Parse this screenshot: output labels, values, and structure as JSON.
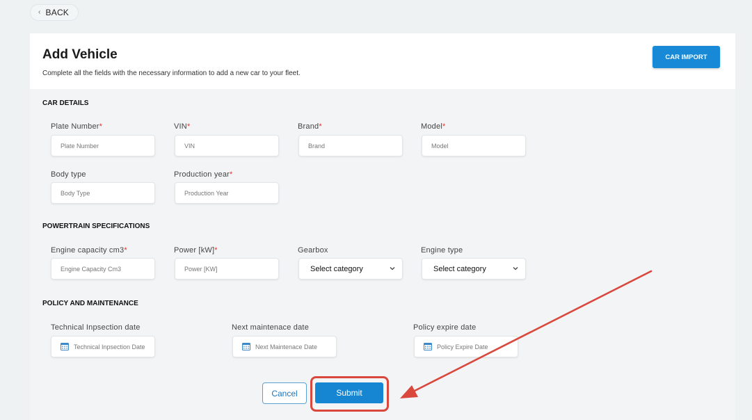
{
  "nav": {
    "back_label": "BACK"
  },
  "header": {
    "title": "Add Vehicle",
    "description": "Complete all the fields with the necessary information to add a new car to your fleet.",
    "car_import_label": "CAR IMPORT"
  },
  "car_details": {
    "title": "CAR DETAILS",
    "plate_number": {
      "label": "Plate Number",
      "required": "*",
      "placeholder": "Plate Number"
    },
    "vin": {
      "label": "VIN",
      "required": "*",
      "placeholder": "VIN"
    },
    "brand": {
      "label": "Brand",
      "required": "*",
      "placeholder": "Brand"
    },
    "model": {
      "label": "Model",
      "required": "*",
      "placeholder": "Model"
    },
    "body_type": {
      "label": "Body type",
      "placeholder": "Body Type"
    },
    "production_year": {
      "label": "Production year",
      "required": "*",
      "placeholder": "Production Year"
    }
  },
  "powertrain": {
    "title": "POWERTRAIN SPECIFICATIONS",
    "engine_capacity": {
      "label": "Engine capacity cm3",
      "required": "*",
      "placeholder": "Engine Capacity Cm3"
    },
    "power": {
      "label": "Power [kW]",
      "required": "*",
      "placeholder": "Power [KW]"
    },
    "gearbox": {
      "label": "Gearbox",
      "value": "Select category"
    },
    "engine_type": {
      "label": "Engine type",
      "value": "Select category"
    }
  },
  "policy": {
    "title": "POLICY AND MAINTENANCE",
    "technical_inspection": {
      "label": "Technical Inpsection date",
      "placeholder": "Technical Inpsection Date"
    },
    "next_maintenance": {
      "label": "Next maintenace date",
      "placeholder": "Next Maintenace Date"
    },
    "policy_expire": {
      "label": "Policy expire date",
      "placeholder": "Policy Expire Date"
    }
  },
  "actions": {
    "cancel_label": "Cancel",
    "submit_label": "Submit"
  },
  "colors": {
    "primary": "#1786d2",
    "required": "#e03131",
    "annotation": "#d9473d",
    "background": "#eef2f3"
  },
  "icons": {
    "back": "chevron-left-icon",
    "dropdown": "chevron-down-icon",
    "date": "calendar-icon"
  }
}
